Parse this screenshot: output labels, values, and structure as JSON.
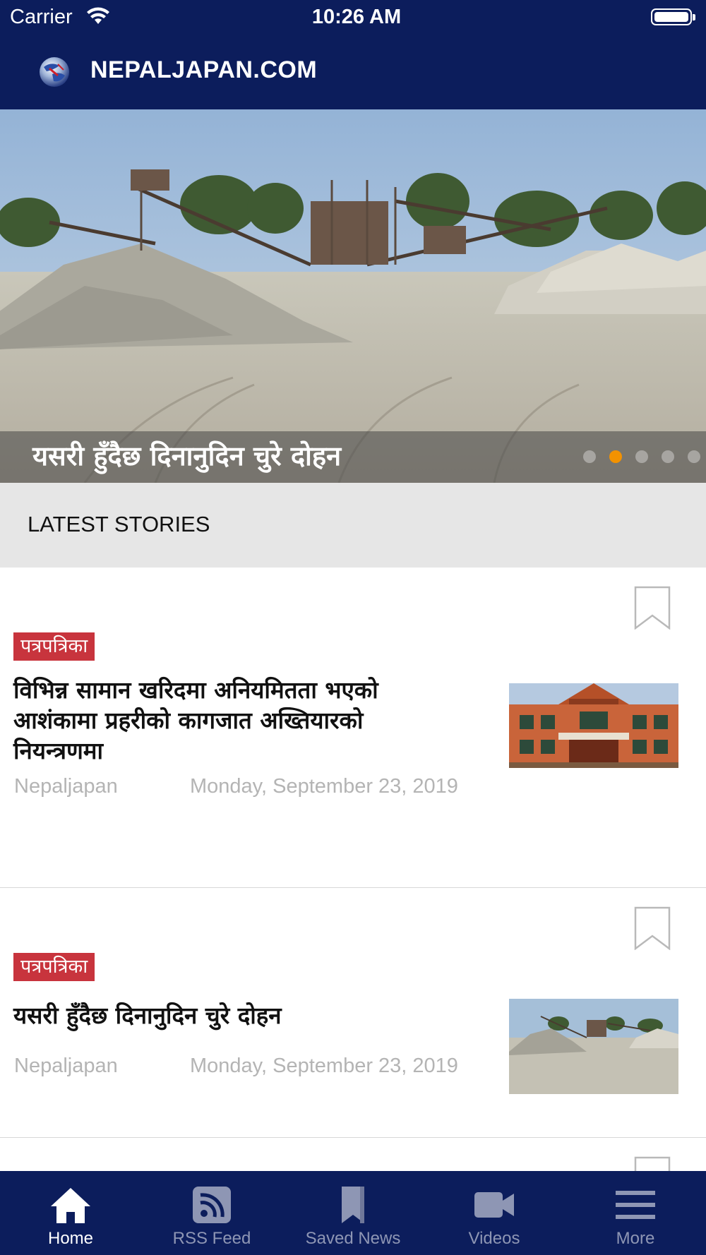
{
  "status_bar": {
    "carrier": "Carrier",
    "time": "10:26 AM"
  },
  "header": {
    "title": "NEPALJAPAN.COM",
    "logo_icon": "globe-logo-icon"
  },
  "hero": {
    "caption": "यसरी हुँदैछ दिनानुदिन चुरे दोहन",
    "slide_count": 5,
    "active_slide": 2,
    "dot_active_color": "#f39200"
  },
  "section": {
    "label": "LATEST STORIES"
  },
  "stories": [
    {
      "tag": "पत्रपत्रिका",
      "title_lines": [
        "विभिन्न सामान खरिदमा अनियमितता भएको",
        "आशंकामा प्रहरीको कागजात अख्तियारको",
        "नियन्त्रणमा"
      ],
      "source": "Nepaljapan",
      "date": "Monday, September 23, 2019",
      "thumb": "building-photo"
    },
    {
      "tag": "पत्रपत्रिका",
      "title_lines": [
        "यसरी हुँदैछ दिनानुदिन चुरे दोहन"
      ],
      "source": "Nepaljapan",
      "date": "Monday, September 23, 2019",
      "thumb": "quarry-photo"
    }
  ],
  "tabbar": {
    "items": [
      {
        "label": "Home",
        "icon": "home-icon",
        "active": true
      },
      {
        "label": "RSS Feed",
        "icon": "rss-icon",
        "active": false
      },
      {
        "label": "Saved News",
        "icon": "bookmark-icon",
        "active": false
      },
      {
        "label": "Videos",
        "icon": "video-camera-icon",
        "active": false
      },
      {
        "label": "More",
        "icon": "menu-icon",
        "active": false
      }
    ]
  },
  "colors": {
    "primary": "#0c1d5c",
    "tag": "#c8343d",
    "section_bg": "#e6e6e6",
    "meta_text": "#b4b4b4"
  }
}
